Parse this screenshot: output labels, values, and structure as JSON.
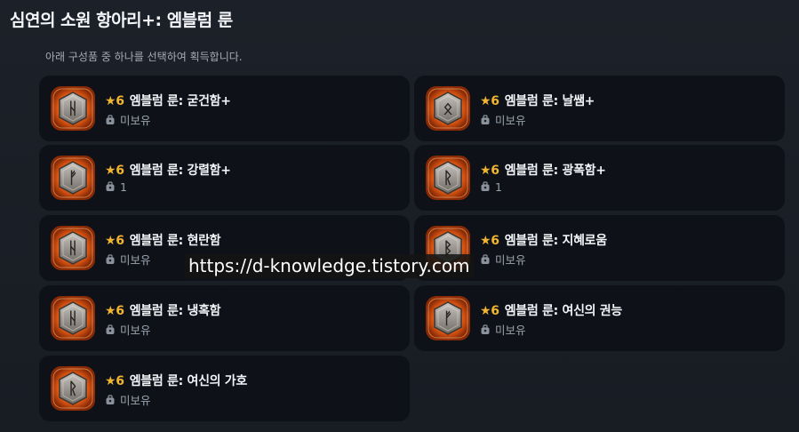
{
  "header": {
    "title": "심연의 소원 항아리+: 엠블럼 룬",
    "subtitle": "아래 구성품 중 하나를 선택하여 획득합니다."
  },
  "items": [
    {
      "star": "★",
      "grade": "6",
      "name": "엠블럼 룬: 굳건함+",
      "owned": "미보유",
      "glyph": "ᚺ"
    },
    {
      "star": "★",
      "grade": "6",
      "name": "엠블럼 룬: 날쌤+",
      "owned": "미보유",
      "glyph": "ᛟ"
    },
    {
      "star": "★",
      "grade": "6",
      "name": "엠블럼 룬: 강렬함+",
      "owned": "1",
      "glyph": "ᚠ"
    },
    {
      "star": "★",
      "grade": "6",
      "name": "엠블럼 룬: 광폭함+",
      "owned": "1",
      "glyph": "ᚱ"
    },
    {
      "star": "★",
      "grade": "6",
      "name": "엠블럼 룬: 현란함",
      "owned": "미보유",
      "glyph": "ᚺ"
    },
    {
      "star": "★",
      "grade": "6",
      "name": "엠블럼 룬: 지혜로움",
      "owned": "미보유",
      "glyph": "ᛒ"
    },
    {
      "star": "★",
      "grade": "6",
      "name": "엠블럼 룬: 냉혹함",
      "owned": "미보유",
      "glyph": "ᚺ"
    },
    {
      "star": "★",
      "grade": "6",
      "name": "엠블럼 룬: 여신의 권능",
      "owned": "미보유",
      "glyph": "ᚠ"
    },
    {
      "star": "★",
      "grade": "6",
      "name": "엠블럼 룬: 여신의 가호",
      "owned": "미보유",
      "glyph": "ᚱ"
    }
  ],
  "colors": {
    "accent_star": "#f1b531",
    "rune_glow": "#ff6a1a",
    "card_bg": "#0e1218"
  },
  "icons": {
    "rune": "rune-emblem-icon",
    "owned": "inventory-bag-icon"
  },
  "watermark": "https://d-knowledge.tistory.com"
}
